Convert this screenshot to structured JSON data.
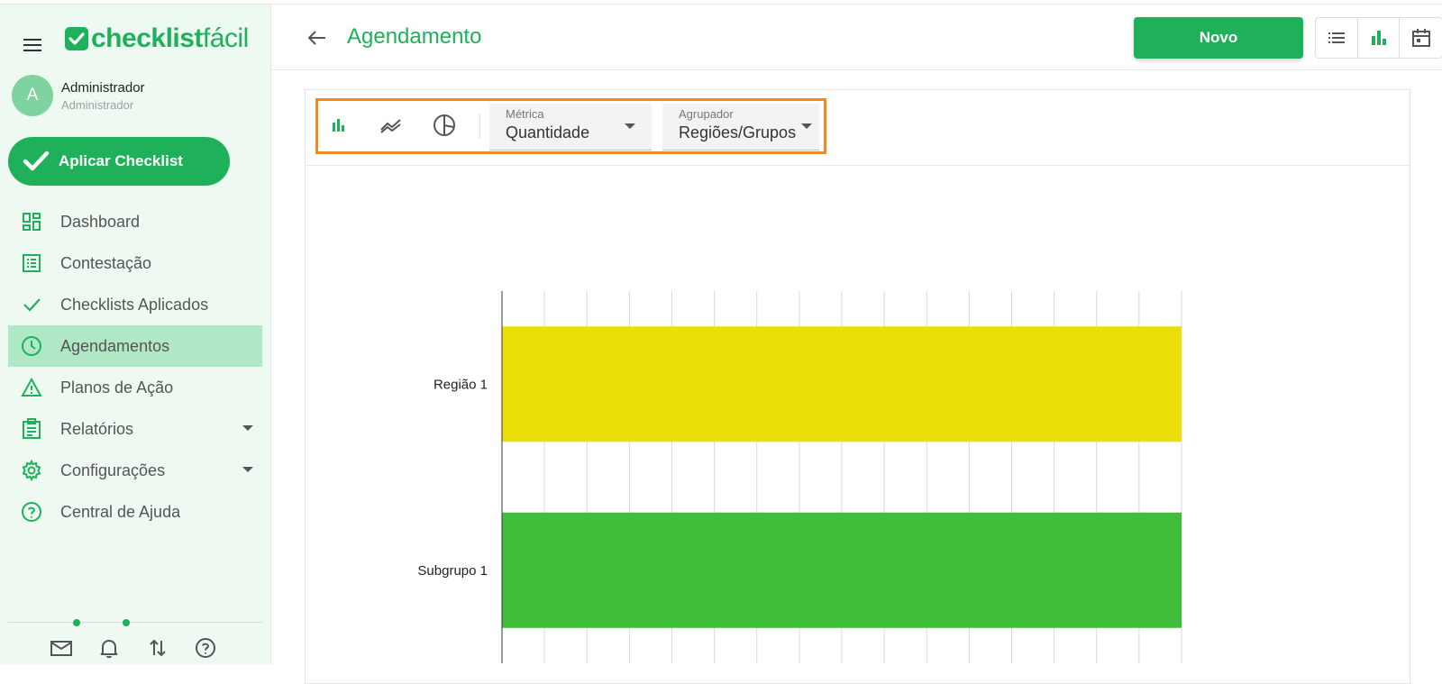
{
  "app": {
    "logo_bold": "checklist",
    "logo_light": "fácil",
    "brand_color": "#1fb15a"
  },
  "user": {
    "initial": "A",
    "name": "Administrador",
    "role": "Administrador"
  },
  "apply_button": "Aplicar Checklist",
  "nav": {
    "items": [
      {
        "label": "Dashboard",
        "icon": "dashboard-icon"
      },
      {
        "label": "Contestação",
        "icon": "list-alt-icon"
      },
      {
        "label": "Checklists Aplicados",
        "icon": "check-icon"
      },
      {
        "label": "Agendamentos",
        "icon": "clock-icon",
        "active": true
      },
      {
        "label": "Planos de Ação",
        "icon": "warning-icon"
      },
      {
        "label": "Relatórios",
        "icon": "clipboard-icon",
        "has_submenu": true
      },
      {
        "label": "Configurações",
        "icon": "gear-icon",
        "has_submenu": true
      },
      {
        "label": "Central de Ajuda",
        "icon": "help-circle-icon"
      }
    ]
  },
  "header": {
    "title": "Agendamento",
    "new_button": "Novo"
  },
  "filters": {
    "metric_label": "Métrica",
    "metric_value": "Quantidade",
    "group_label": "Agrupador",
    "group_value": "Regiões/Grupos"
  },
  "chart_data": {
    "type": "bar",
    "orientation": "horizontal",
    "categories": [
      "Região 1",
      "Subgrupo 1"
    ],
    "values": [
      40,
      40
    ],
    "colors": [
      "#ebdf0a",
      "#40bd3b"
    ],
    "xlim": [
      0,
      40
    ],
    "xticks": [
      0,
      5,
      10,
      15,
      20,
      25,
      30,
      35,
      40
    ],
    "grid": true
  }
}
